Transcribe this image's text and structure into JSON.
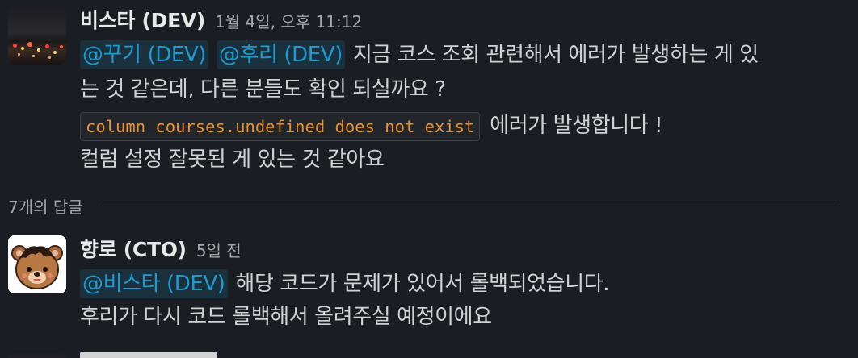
{
  "message": {
    "sender": "비스타 (DEV)",
    "timestamp": "1월 4일, 오후 11:12",
    "mentions": [
      "@꾸기 (DEV)",
      "@후리 (DEV)"
    ],
    "line1_text": "지금 코스 조회 관련해서 에러가 발생하는 게 있",
    "line2_text": "는 것 같은데, 다른 분들도 확인 되실까요 ?",
    "code": "column courses.undefined does not exist",
    "line3_text": "에러가 발생합니다 !",
    "line4_text": "컬럼 설정 잘못된 게 있는 것 같아요"
  },
  "replies_label": "7개의 답글",
  "reply": {
    "sender": "향로 (CTO)",
    "timestamp": "5일 전",
    "mention": "@비스타 (DEV)",
    "line1_text": "해당 코드가 문제가 있어서 롤백되었습니다.",
    "line2_text": "후리가 다시 코드 롤백해서 올려주실 예정이에요"
  },
  "colors": {
    "background": "#1a1d21",
    "text": "#d1d2d3",
    "mention": "#1d9bd1",
    "code": "#e8912d",
    "muted": "#a6a7a9"
  },
  "icons": {
    "avatar_1": "city-night-photo-avatar",
    "avatar_2": "bear-avatar"
  }
}
